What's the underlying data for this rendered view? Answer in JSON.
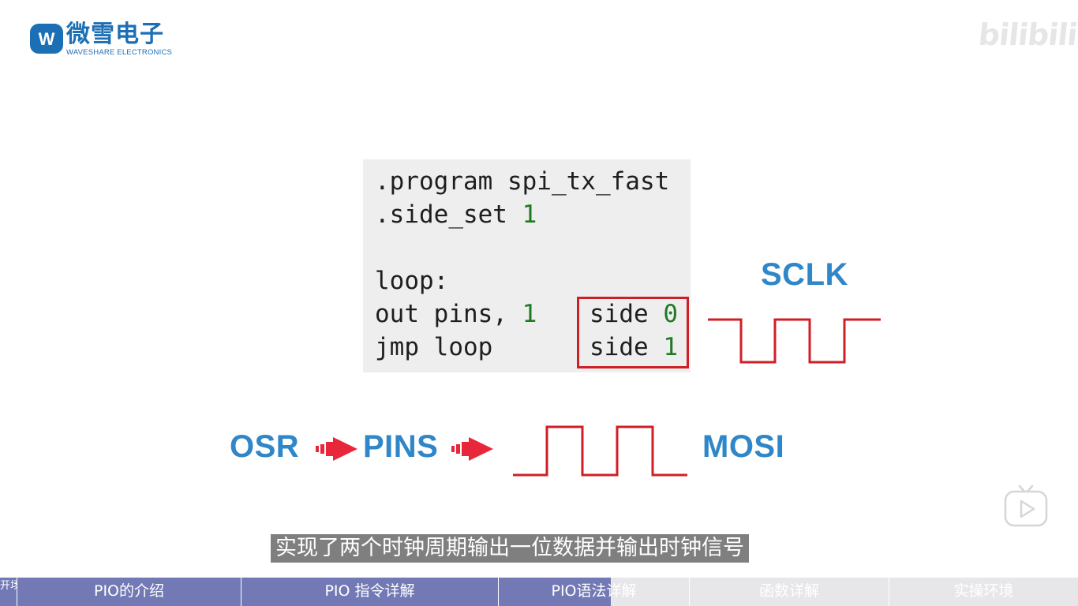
{
  "logo": {
    "name_cn": "微雪电子",
    "name_en": "WAVESHARE ELECTRONICS",
    "mark_letter": "W"
  },
  "watermark": "bilibili",
  "code": {
    "lines": [
      {
        "text": ".program spi_tx_fast",
        "num": ""
      },
      {
        "text": ".side_set ",
        "num": "1"
      },
      {
        "text": "",
        "num": ""
      },
      {
        "text": "loop:",
        "num": ""
      },
      {
        "text": "out pins, ",
        "num": "1"
      },
      {
        "text": "jmp loop",
        "num": ""
      }
    ],
    "side_lines": [
      {
        "text": "side ",
        "num": "0"
      },
      {
        "text": "side ",
        "num": "1"
      }
    ]
  },
  "labels": {
    "sclk": "SCLK",
    "osr": "OSR",
    "pins": "PINS",
    "mosi": "MOSI"
  },
  "subtitle": "实现了两个时钟周期输出一位数据并输出时钟信号",
  "chapters": [
    {
      "label": "开场",
      "state": "done"
    },
    {
      "label": "PIO的介绍",
      "state": "done"
    },
    {
      "label": "PIO 指令详解",
      "state": "done"
    },
    {
      "label": "PIO语法详解",
      "state": "partial",
      "progress": 0.59
    },
    {
      "label": "函数详解",
      "state": "future"
    },
    {
      "label": "实操环境",
      "state": "future"
    }
  ],
  "colors": {
    "brand_blue": "#1c6fb5",
    "label_blue": "#2f86c8",
    "signal_red": "#cf1f26",
    "arrow_red": "#e8273a",
    "code_green": "#1f7a22",
    "chapter_done": "#7279b5"
  }
}
